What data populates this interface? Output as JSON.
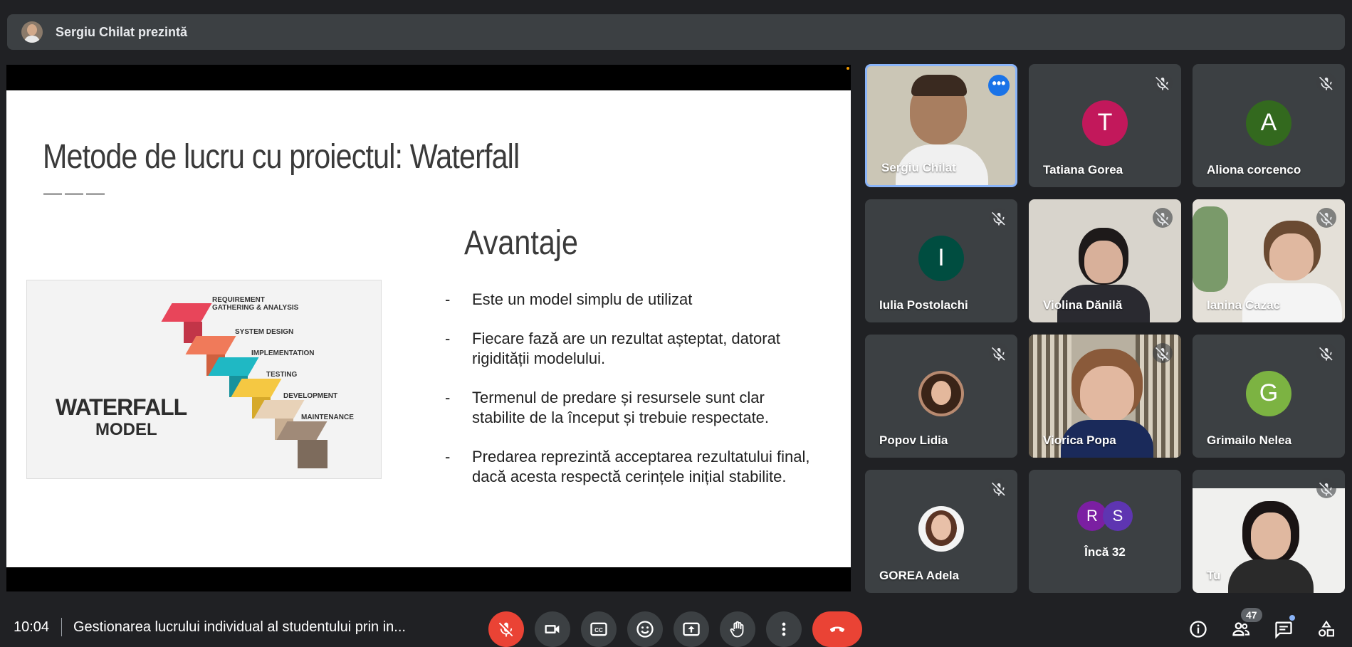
{
  "presenter_bar": {
    "label": "Sergiu Chilat prezintă"
  },
  "slide": {
    "title": "Metode de lucru cu proiectul: Waterfall",
    "separator": "———",
    "section": "Avantaje",
    "bullets": [
      "Este un model simplu de utilizat",
      "Fiecare fază are un rezultat așteptat, datorat rigidității modelului.",
      "Termenul de predare și resursele sunt clar stabilite de la început și trebuie respectate.",
      "Predarea reprezintă acceptarea rezultatului final, dacă acesta respectă cerințele inițial stabilite."
    ],
    "image": {
      "title_line1": "WATERFALL",
      "title_line2": "MODEL",
      "steps": [
        "REQUIREMENT",
        "GATHERING & ANALYSIS",
        "SYSTEM DESIGN",
        "IMPLEMENTATION",
        "TESTING",
        "DEVELOPMENT",
        "MAINTENANCE"
      ],
      "colors": [
        "#e8455a",
        "#f07a5a",
        "#1fb8c4",
        "#f5c842",
        "#e8d2b8",
        "#a08a78"
      ]
    }
  },
  "participants": [
    {
      "name": "Sergiu Chilat",
      "type": "video",
      "highlight": true
    },
    {
      "name": "Tatiana Gorea",
      "type": "initial",
      "initial": "T",
      "color": "#c2185b"
    },
    {
      "name": "Aliona corcenco",
      "type": "initial",
      "initial": "A",
      "color": "#33691e"
    },
    {
      "name": "Iulia Postolachi",
      "type": "initial",
      "initial": "I",
      "color": "#004d40"
    },
    {
      "name": "Violina Dănilă",
      "type": "video"
    },
    {
      "name": "Ianina Cazac",
      "type": "video"
    },
    {
      "name": "Popov Lidia",
      "type": "photo"
    },
    {
      "name": "Viorica Popa",
      "type": "video"
    },
    {
      "name": "Grimailo Nelea",
      "type": "initial",
      "initial": "G",
      "color": "#7cb342"
    },
    {
      "name": "GOREA Adela",
      "type": "photo"
    },
    {
      "name": "Încă 32",
      "type": "more",
      "initials": [
        "R",
        "S"
      ],
      "colors": [
        "#7b1fa2",
        "#5e35b1"
      ]
    },
    {
      "name": "Tu",
      "type": "video"
    }
  ],
  "bottom": {
    "time": "10:04",
    "meeting_title": "Gestionarea lucrului individual al studentului prin in...",
    "participants_count": "47"
  },
  "colors": {
    "accent": "#8ab4f8",
    "danger": "#ea4335",
    "tile": "#3c4043",
    "background": "#202124"
  }
}
